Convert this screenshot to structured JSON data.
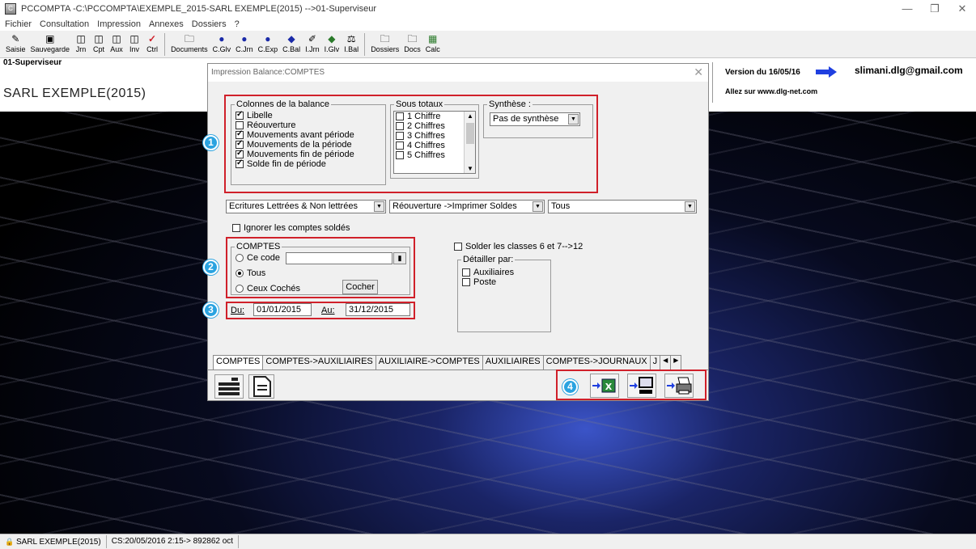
{
  "window": {
    "title": "PCCOMPTA -C:\\PCCOMPTA\\EXEMPLE_2015-SARL EXEMPLE(2015) -->01-Superviseur"
  },
  "menu": [
    "Fichier",
    "Consultation",
    "Impression",
    "Annexes",
    "Dossiers",
    "?"
  ],
  "toolbar": [
    {
      "label": "Saisie",
      "icon": "edit-icon"
    },
    {
      "label": "Sauvegarde",
      "icon": "save-icon"
    },
    {
      "label": "Jrn",
      "icon": "journal-icon"
    },
    {
      "label": "Cpt",
      "icon": "account-icon"
    },
    {
      "label": "Aux",
      "icon": "auxiliary-icon"
    },
    {
      "label": "Inv",
      "icon": "inventory-icon"
    },
    {
      "label": "Ctrl",
      "icon": "check-icon"
    },
    {
      "label": "Documents",
      "icon": "folder-icon"
    },
    {
      "label": "C.Glv",
      "icon": "circle-icon"
    },
    {
      "label": "C.Jrn",
      "icon": "circle-icon"
    },
    {
      "label": "C.Exp",
      "icon": "circle-icon"
    },
    {
      "label": "C.Bal",
      "icon": "diamond-icon"
    },
    {
      "label": "I.Jrn",
      "icon": "pen-icon"
    },
    {
      "label": "I.Glv",
      "icon": "diamond-icon"
    },
    {
      "label": "I.Bal",
      "icon": "scale-icon"
    },
    {
      "label": "Dossiers",
      "icon": "folder-icon"
    },
    {
      "label": "Docs",
      "icon": "folder-icon"
    },
    {
      "label": "Calc",
      "icon": "calculator-icon"
    }
  ],
  "header": {
    "user": "01-Superviseur",
    "company": "SARL EXEMPLE(2015)",
    "version": "Version du 16/05/16",
    "site": "Allez sur www.dlg-net.com",
    "email": "slimani.dlg@gmail.com"
  },
  "dialog": {
    "title": "Impression Balance:COMPTES",
    "colonnes": {
      "title": "Colonnes de la balance",
      "items": [
        {
          "label": "Libelle",
          "checked": true
        },
        {
          "label": "Réouverture",
          "checked": false
        },
        {
          "label": "Mouvements avant période",
          "checked": true
        },
        {
          "label": "Mouvements de la période",
          "checked": true
        },
        {
          "label": "Mouvements fin de période",
          "checked": true
        },
        {
          "label": "Solde fin de période",
          "checked": true
        }
      ]
    },
    "sous_totaux": {
      "title": "Sous totaux",
      "items": [
        "1 Chiffre",
        "2 Chiffres",
        "3 Chiffres",
        "4 Chiffres",
        "5 Chiffres"
      ]
    },
    "synthese": {
      "title": "Synthèse :",
      "value": "Pas de synthèse"
    },
    "filters": {
      "ecritures": "Ecritures Lettrées & Non lettrées",
      "reouverture": "Réouverture ->Imprimer Soldes",
      "tous": "Tous"
    },
    "ignorer": "Ignorer les comptes soldés",
    "comptes": {
      "title": "COMPTES",
      "ce_code": "Ce code",
      "tous": "Tous",
      "ceux_coches": "Ceux Cochés",
      "cocher": "Cocher",
      "selected": "Tous"
    },
    "dates": {
      "du_label": "Du:",
      "du": "01/01/2015",
      "au_label": "Au:",
      "au": "31/12/2015"
    },
    "solder": "Solder les classes 6 et 7-->12",
    "detailler": {
      "title": "Détailler par:",
      "items": [
        "Auxiliaires",
        "Poste"
      ]
    },
    "tabs": [
      "COMPTES",
      "COMPTES->AUXILIAIRES",
      "AUXILIAIRE->COMPTES",
      "AUXILIAIRES",
      "COMPTES->JOURNAUX",
      "J"
    ],
    "badges": [
      "1",
      "2",
      "3",
      "4"
    ]
  },
  "status": {
    "company": "SARL EXEMPLE(2015)",
    "info": "CS:20/05/2016 2:15-> 892862 oct"
  },
  "colors": {
    "accent_red": "#d0202a",
    "badge_blue": "#2aa3e0"
  }
}
